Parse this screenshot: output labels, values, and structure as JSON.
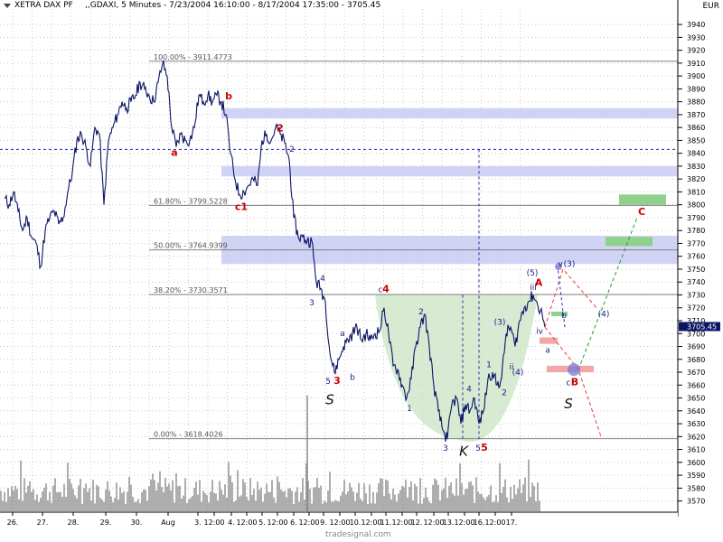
{
  "header": {
    "symbol": "XETRA DAX PF",
    "params": ",,GDAXI, 5 Minutes - 7/23/2004 16:10:00 - 8/17/2004 17:35:00 - 3705.45",
    "currency": "EUR"
  },
  "watermark": "tradesignal.com",
  "chart_data": {
    "type": "line",
    "ylim": [
      3562,
      3952
    ],
    "y_ticks": [
      3570,
      3580,
      3590,
      3600,
      3610,
      3620,
      3630,
      3640,
      3650,
      3660,
      3670,
      3680,
      3690,
      3700,
      3710,
      3720,
      3730,
      3740,
      3750,
      3760,
      3770,
      3780,
      3790,
      3800,
      3810,
      3820,
      3830,
      3840,
      3850,
      3860,
      3870,
      3880,
      3890,
      3900,
      3910,
      3920,
      3930,
      3940
    ],
    "x_tick_labels": [
      "26.",
      "27.",
      "28.",
      "29.",
      "30.",
      "Aug",
      "3.",
      "12:00",
      "4.",
      "12:00",
      "5.",
      "12:00",
      "6.",
      "12:00",
      "9.",
      "12:00",
      "10.",
      "12:00",
      "11.",
      "12:00",
      "12.",
      "12:00",
      "13.",
      "12:00",
      "16.",
      "12:00",
      "17."
    ],
    "last_price": 3705.45,
    "fibonacci": [
      {
        "label": "100.00% - 3911.4773",
        "value": 3911.48
      },
      {
        "label": "61.80% - 3799.5228",
        "value": 3799.52
      },
      {
        "label": "50.00% - 3764.9399",
        "value": 3764.94
      },
      {
        "label": "38.20% - 3730.3571",
        "value": 3730.36
      },
      {
        "label": "0.00% - 3618.4026",
        "value": 3618.4
      }
    ],
    "resistance_zones": [
      [
        3867,
        3875
      ],
      [
        3822,
        3830
      ],
      [
        3754,
        3776
      ]
    ],
    "target_zones": [
      [
        3800,
        3808
      ],
      [
        3768,
        3775
      ]
    ],
    "support_zones": [
      [
        3670,
        3675
      ],
      [
        3692,
        3697
      ]
    ],
    "price_points": [
      [
        0,
        3805
      ],
      [
        5,
        3800
      ],
      [
        10,
        3810
      ],
      [
        15,
        3795
      ],
      [
        20,
        3780
      ],
      [
        25,
        3790
      ],
      [
        30,
        3775
      ],
      [
        35,
        3770
      ],
      [
        40,
        3752
      ],
      [
        45,
        3780
      ],
      [
        50,
        3790
      ],
      [
        55,
        3795
      ],
      [
        60,
        3785
      ],
      [
        65,
        3790
      ],
      [
        70,
        3810
      ],
      [
        75,
        3825
      ],
      [
        80,
        3850
      ],
      [
        85,
        3855
      ],
      [
        90,
        3845
      ],
      [
        95,
        3830
      ],
      [
        100,
        3860
      ],
      [
        105,
        3855
      ],
      [
        110,
        3800
      ],
      [
        115,
        3850
      ],
      [
        120,
        3860
      ],
      [
        125,
        3870
      ],
      [
        130,
        3880
      ],
      [
        135,
        3875
      ],
      [
        140,
        3880
      ],
      [
        145,
        3885
      ],
      [
        150,
        3895
      ],
      [
        155,
        3890
      ],
      [
        160,
        3885
      ],
      [
        165,
        3880
      ],
      [
        170,
        3895
      ],
      [
        175,
        3910
      ],
      [
        180,
        3900
      ],
      [
        185,
        3860
      ],
      [
        190,
        3845
      ],
      [
        195,
        3855
      ],
      [
        200,
        3850
      ],
      [
        205,
        3850
      ],
      [
        210,
        3860
      ],
      [
        215,
        3885
      ],
      [
        220,
        3880
      ],
      [
        225,
        3885
      ],
      [
        230,
        3880
      ],
      [
        235,
        3885
      ],
      [
        240,
        3880
      ],
      [
        245,
        3870
      ],
      [
        250,
        3840
      ],
      [
        255,
        3820
      ],
      [
        260,
        3808
      ],
      [
        265,
        3810
      ],
      [
        270,
        3815
      ],
      [
        275,
        3820
      ],
      [
        280,
        3815
      ],
      [
        285,
        3850
      ],
      [
        290,
        3855
      ],
      [
        295,
        3850
      ],
      [
        300,
        3860
      ],
      [
        305,
        3855
      ],
      [
        310,
        3848
      ],
      [
        315,
        3835
      ],
      [
        320,
        3790
      ],
      [
        325,
        3775
      ],
      [
        330,
        3775
      ],
      [
        335,
        3772
      ],
      [
        340,
        3772
      ],
      [
        345,
        3740
      ],
      [
        350,
        3735
      ],
      [
        355,
        3725
      ],
      [
        360,
        3685
      ],
      [
        365,
        3670
      ],
      [
        370,
        3680
      ],
      [
        375,
        3690
      ],
      [
        380,
        3695
      ],
      [
        385,
        3700
      ],
      [
        390,
        3705
      ],
      [
        395,
        3695
      ],
      [
        400,
        3700
      ],
      [
        405,
        3695
      ],
      [
        410,
        3700
      ],
      [
        415,
        3702
      ],
      [
        420,
        3720
      ],
      [
        425,
        3700
      ],
      [
        430,
        3675
      ],
      [
        435,
        3672
      ],
      [
        440,
        3660
      ],
      [
        445,
        3650
      ],
      [
        450,
        3665
      ],
      [
        455,
        3690
      ],
      [
        460,
        3705
      ],
      [
        465,
        3715
      ],
      [
        470,
        3690
      ],
      [
        475,
        3660
      ],
      [
        480,
        3640
      ],
      [
        485,
        3625
      ],
      [
        490,
        3618
      ],
      [
        495,
        3645
      ],
      [
        500,
        3650
      ],
      [
        505,
        3630
      ],
      [
        510,
        3645
      ],
      [
        515,
        3640
      ],
      [
        520,
        3650
      ],
      [
        525,
        3630
      ],
      [
        530,
        3640
      ],
      [
        535,
        3665
      ],
      [
        540,
        3670
      ],
      [
        545,
        3660
      ],
      [
        550,
        3665
      ],
      [
        555,
        3700
      ],
      [
        560,
        3705
      ],
      [
        565,
        3690
      ],
      [
        570,
        3710
      ],
      [
        575,
        3720
      ],
      [
        580,
        3725
      ],
      [
        585,
        3730
      ],
      [
        590,
        3722
      ],
      [
        595,
        3715
      ],
      [
        598,
        3705
      ]
    ],
    "volume_note": "volume histogram at bottom",
    "projection_points": [
      [
        598,
        3705
      ],
      [
        618,
        3750
      ],
      [
        655,
        3720
      ],
      [
        635,
        3672
      ],
      [
        700,
        3790
      ]
    ],
    "wave_labels": [
      {
        "text": "b",
        "color": "#cc0000",
        "price": 3882,
        "t": 248
      },
      {
        "text": "a",
        "color": "#cc0000",
        "price": 3838,
        "t": 188
      },
      {
        "text": "2",
        "color": "#cc0000",
        "price": 3857,
        "t": 305
      },
      {
        "text": "2",
        "color": "#1a1a8c",
        "price": 3841,
        "t": 318
      },
      {
        "text": "c1",
        "color": "#cc0000",
        "price": 3796,
        "t": 262
      },
      {
        "text": "4",
        "color": "#1a1a8c",
        "price": 3741,
        "t": 352
      },
      {
        "text": "3",
        "color": "#1a1a8c",
        "price": 3722,
        "t": 340
      },
      {
        "text": "a",
        "color": "#1a1a8c",
        "price": 3698,
        "t": 374
      },
      {
        "text": "b",
        "color": "#1a1a8c",
        "price": 3664,
        "t": 385
      },
      {
        "text": "5",
        "color": "#1a1a8c",
        "price": 3661,
        "t": 358
      },
      {
        "text": "3",
        "color": "#cc0000",
        "price": 3661,
        "t": 368
      },
      {
        "text": "c",
        "color": "#1a1a8c",
        "price": 3732,
        "t": 416
      },
      {
        "text": "4",
        "color": "#cc0000",
        "price": 3732,
        "t": 422
      },
      {
        "text": "2",
        "color": "#1a1a8c",
        "price": 3715,
        "t": 461
      },
      {
        "text": "1",
        "color": "#1a1a8c",
        "price": 3640,
        "t": 448
      },
      {
        "text": "3",
        "color": "#1a1a8c",
        "price": 3609,
        "t": 488
      },
      {
        "text": "4",
        "color": "#1a1a8c",
        "price": 3655,
        "t": 514
      },
      {
        "text": "5",
        "color": "#1a1a8c",
        "price": 3609,
        "t": 524
      },
      {
        "text": "5",
        "color": "#cc0000",
        "price": 3609,
        "t": 531
      },
      {
        "text": "1",
        "color": "#1a1a8c",
        "price": 3674,
        "t": 536
      },
      {
        "text": "2",
        "color": "#1a1a8c",
        "price": 3652,
        "t": 553
      },
      {
        "text": "(3)",
        "color": "#1a1a8c",
        "price": 3707,
        "t": 548
      },
      {
        "text": "ii",
        "color": "#1a1a8c",
        "price": 3672,
        "t": 561
      },
      {
        "text": "(4)",
        "color": "#1a1a8c",
        "price": 3668,
        "t": 568
      },
      {
        "text": "(5)",
        "color": "#1a1a8c",
        "price": 3745,
        "t": 584
      },
      {
        "text": "iii",
        "color": "#1a1a8c",
        "price": 3734,
        "t": 585
      },
      {
        "text": "A",
        "color": "#cc0000",
        "price": 3737,
        "t": 591
      },
      {
        "text": "iv",
        "color": "#1a1a8c",
        "price": 3700,
        "t": 592
      },
      {
        "text": "a",
        "color": "#1a1a8c",
        "price": 3685,
        "t": 601
      },
      {
        "text": "b",
        "color": "#1a1a8c",
        "price": 3712,
        "t": 619
      },
      {
        "text": "v",
        "color": "#1a1a8c",
        "price": 3752,
        "t": 615
      },
      {
        "text": "(3)",
        "color": "#1a1a8c",
        "price": 3752,
        "t": 625
      },
      {
        "text": "(4)",
        "color": "#1a1a8c",
        "price": 3713,
        "t": 663
      },
      {
        "text": "c",
        "color": "#1a1a8c",
        "price": 3660,
        "t": 624
      },
      {
        "text": "B",
        "color": "#cc0000",
        "price": 3660,
        "t": 631
      },
      {
        "text": "C",
        "color": "#cc0000",
        "price": 3792,
        "t": 705
      }
    ],
    "pattern_labels": [
      {
        "text": "S",
        "price": 3645,
        "t": 360
      },
      {
        "text": "K",
        "price": 3605,
        "t": 508
      },
      {
        "text": "S",
        "price": 3642,
        "t": 624
      }
    ],
    "cursor": {
      "t": 525,
      "price": 3843
    }
  }
}
